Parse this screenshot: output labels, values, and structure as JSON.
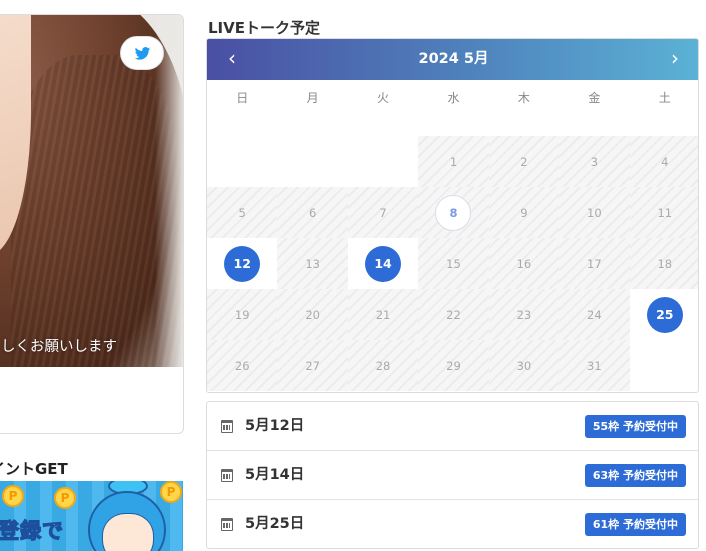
{
  "profile": {
    "caption": "しくお願いします",
    "twitter_icon": "twitter-icon"
  },
  "point_section": {
    "title": "イントGET",
    "banner_text": "登録で",
    "coin_label": "P"
  },
  "calendar": {
    "section_title": "LIVEトーク予定",
    "month_label": "2024 5月",
    "prev_label": "‹",
    "next_label": "›",
    "weekdays": [
      "日",
      "月",
      "火",
      "水",
      "木",
      "金",
      "土"
    ],
    "days": [
      {
        "label": "",
        "state": "empty"
      },
      {
        "label": "",
        "state": "empty"
      },
      {
        "label": "",
        "state": "empty"
      },
      {
        "label": "1",
        "state": "filled"
      },
      {
        "label": "2",
        "state": "filled"
      },
      {
        "label": "3",
        "state": "filled"
      },
      {
        "label": "4",
        "state": "filled"
      },
      {
        "label": "5",
        "state": "filled"
      },
      {
        "label": "6",
        "state": "filled"
      },
      {
        "label": "7",
        "state": "filled"
      },
      {
        "label": "8",
        "state": "today"
      },
      {
        "label": "9",
        "state": "filled"
      },
      {
        "label": "10",
        "state": "filled"
      },
      {
        "label": "11",
        "state": "filled"
      },
      {
        "label": "12",
        "state": "available"
      },
      {
        "label": "13",
        "state": "filled"
      },
      {
        "label": "14",
        "state": "available"
      },
      {
        "label": "15",
        "state": "filled"
      },
      {
        "label": "16",
        "state": "filled"
      },
      {
        "label": "17",
        "state": "filled"
      },
      {
        "label": "18",
        "state": "filled"
      },
      {
        "label": "19",
        "state": "filled"
      },
      {
        "label": "20",
        "state": "filled"
      },
      {
        "label": "21",
        "state": "filled"
      },
      {
        "label": "22",
        "state": "filled"
      },
      {
        "label": "23",
        "state": "filled"
      },
      {
        "label": "24",
        "state": "filled"
      },
      {
        "label": "25",
        "state": "available"
      },
      {
        "label": "26",
        "state": "filled"
      },
      {
        "label": "27",
        "state": "filled"
      },
      {
        "label": "28",
        "state": "filled"
      },
      {
        "label": "29",
        "state": "filled"
      },
      {
        "label": "30",
        "state": "filled"
      },
      {
        "label": "31",
        "state": "filled"
      },
      {
        "label": "",
        "state": "empty"
      }
    ]
  },
  "schedule": [
    {
      "date": "5月12日",
      "badge": "55枠 予約受付中"
    },
    {
      "date": "5月14日",
      "badge": "63枠 予約受付中"
    },
    {
      "date": "5月25日",
      "badge": "61枠 予約受付中"
    }
  ],
  "colors": {
    "accent": "#2d6cd6",
    "header_start": "#4a4fa3",
    "header_end": "#5bb2d6",
    "twitter": "#1d9bf0"
  }
}
